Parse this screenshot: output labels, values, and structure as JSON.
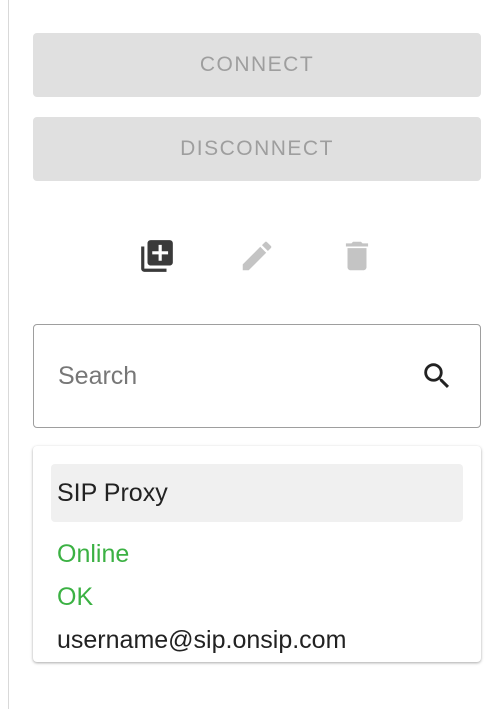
{
  "buttons": {
    "connect_label": "CONNECT",
    "disconnect_label": "DISCONNECT"
  },
  "toolbar": {
    "add_icon": "add-to-library-icon",
    "edit_icon": "pencil-icon",
    "delete_icon": "trash-icon"
  },
  "search": {
    "placeholder": "Search",
    "value": "",
    "icon": "search-icon"
  },
  "account_card": {
    "title": "SIP Proxy",
    "status": "Online",
    "state": "OK",
    "account": "username@sip.onsip.com"
  },
  "colors": {
    "button_bg": "#e0e0e0",
    "button_text": "#9e9e9e",
    "status_green": "#3bb143",
    "active_icon": "#3a3a3a",
    "disabled_icon": "#c4c4c4"
  }
}
